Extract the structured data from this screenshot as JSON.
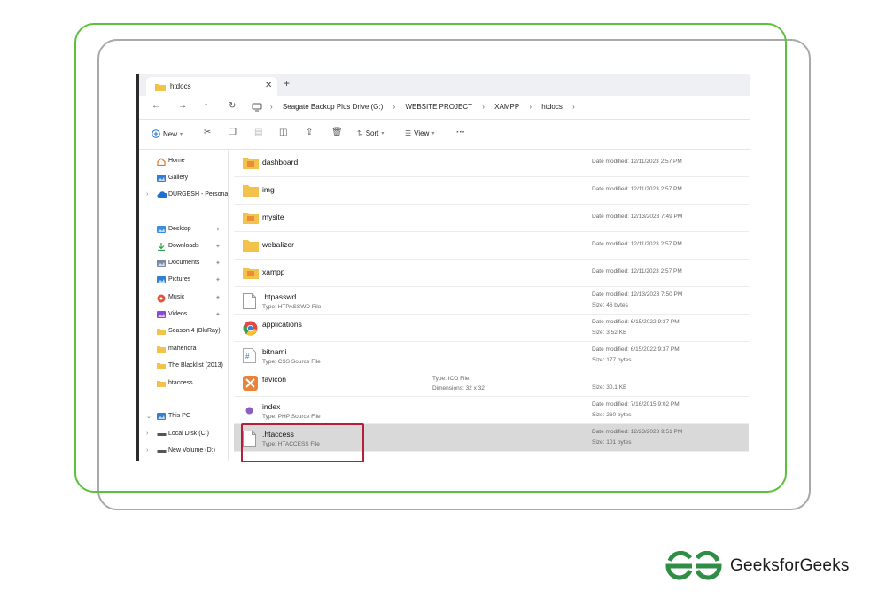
{
  "tab": {
    "title": "htdocs",
    "close": "✕",
    "add": "+"
  },
  "nav": {
    "buttons": [
      "←",
      "→",
      "↑",
      "↻"
    ],
    "breadcrumb": [
      "Seagate Backup Plus Drive (G:)",
      "WEBSITE PROJECT",
      "XAMPP",
      "htdocs"
    ],
    "sep": "›"
  },
  "toolbar": {
    "new": "New",
    "sort": "Sort",
    "view": "View",
    "more": "···"
  },
  "sidebar": {
    "items": [
      {
        "label": "Home",
        "icon": "home-icon",
        "color": "#d97a2b"
      },
      {
        "label": "Gallery",
        "icon": "gallery-icon",
        "color": "#2f7fd6"
      },
      {
        "label": "DURGESH - Persona",
        "icon": "onedrive-icon",
        "color": "#1f6fd1"
      },
      {
        "label": "Desktop",
        "icon": "desktop-icon",
        "color": "#3a8de0"
      },
      {
        "label": "Downloads",
        "icon": "download-icon",
        "color": "#2ea04f"
      },
      {
        "label": "Documents",
        "icon": "documents-icon",
        "color": "#7a8aa6"
      },
      {
        "label": "Pictures",
        "icon": "pictures-icon",
        "color": "#2f7fd6"
      },
      {
        "label": "Music",
        "icon": "music-icon",
        "color": "#e0553a"
      },
      {
        "label": "Videos",
        "icon": "videos-icon",
        "color": "#8a4ad6"
      },
      {
        "label": "Season 4 (BluRay)",
        "icon": "folder-icon",
        "color": "#f3c24b"
      },
      {
        "label": "mahendra",
        "icon": "folder-icon",
        "color": "#f3c24b"
      },
      {
        "label": "The Blacklist (2013)",
        "icon": "folder-icon",
        "color": "#f3c24b"
      },
      {
        "label": "htaccess",
        "icon": "folder-icon",
        "color": "#f3c24b"
      },
      {
        "label": "This PC",
        "icon": "pc-icon",
        "color": "#2f7fd6"
      },
      {
        "label": "Local Disk (C:)",
        "icon": "disk-icon",
        "color": "#555555"
      },
      {
        "label": "New Volume (D:)",
        "icon": "disk-icon",
        "color": "#555555"
      }
    ]
  },
  "files": [
    {
      "name": "dashboard",
      "kind": "folder-special",
      "meta1": "Date modified: 12/11/2023 2:57 PM"
    },
    {
      "name": "img",
      "kind": "folder",
      "meta1": "Date modified: 12/11/2023 2:57 PM"
    },
    {
      "name": "mysite",
      "kind": "folder-special",
      "meta1": "Date modified: 12/13/2023 7:49 PM"
    },
    {
      "name": "webalizer",
      "kind": "folder",
      "meta1": "Date modified: 12/11/2023 2:57 PM"
    },
    {
      "name": "xampp",
      "kind": "folder-special",
      "meta1": "Date modified: 12/11/2023 2:57 PM"
    },
    {
      "name": ".htpasswd",
      "kind": "file",
      "type": "Type: HTPASSWD File",
      "meta1": "Date modified: 12/13/2023 7:50 PM",
      "meta2": "Size: 46 bytes"
    },
    {
      "name": "applications",
      "kind": "chrome",
      "meta1": "Date modified: 6/15/2022 9:37 PM",
      "meta2": "Size: 3.52 KB"
    },
    {
      "name": "bitnami",
      "kind": "css",
      "type": "Type: CSS Source File",
      "meta1": "Date modified: 6/15/2022 9:37 PM",
      "meta2": "Size: 177 bytes"
    },
    {
      "name": "favicon",
      "kind": "ico",
      "mid1": "Type: ICO File",
      "mid2": "Dimensions: 32 x 32",
      "meta2": "Size: 30.1 KB"
    },
    {
      "name": "index",
      "kind": "php",
      "type": "Type: PHP Source File",
      "meta1": "Date modified: 7/16/2015 9:02 PM",
      "meta2": "Size: 260 bytes"
    },
    {
      "name": ".htaccess",
      "kind": "file",
      "type": "Type: HTACCESS File",
      "meta1": "Date modified: 12/23/2023 9:51 PM",
      "meta2": "Size: 101 bytes",
      "selected": true
    }
  ],
  "brand": {
    "name": "GeeksforGeeks",
    "color": "#2f8d46"
  },
  "colors": {
    "frame_green": "#5cc03c",
    "frame_gray": "#a9a9a9",
    "highlight": "#b51f3a",
    "folder": "#f3c24b"
  }
}
